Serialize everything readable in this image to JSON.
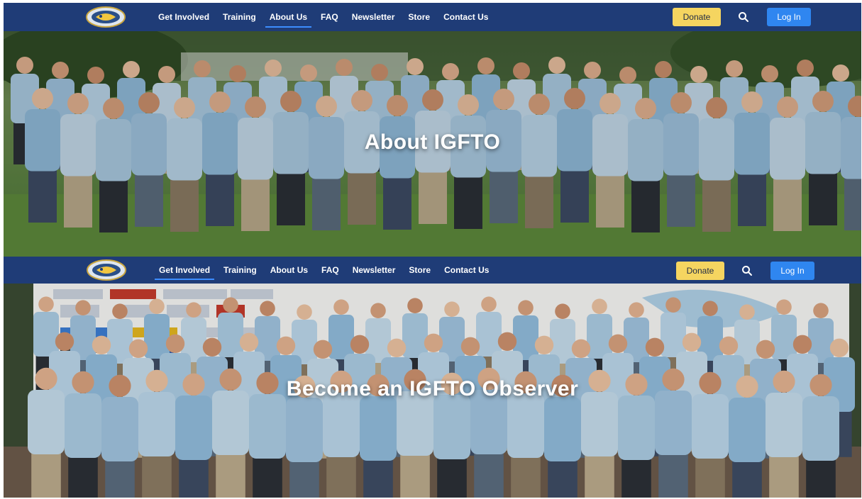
{
  "screens": [
    {
      "nav": {
        "items": [
          "Get Involved",
          "Training",
          "About Us",
          "FAQ",
          "Newsletter",
          "Store",
          "Contact Us"
        ],
        "active_index": 2,
        "donate_label": "Donate",
        "login_label": "Log In",
        "search_icon": "search-icon",
        "logo_icon": "fish-logo-icon"
      },
      "hero": {
        "title": "About IGFTO"
      }
    },
    {
      "nav": {
        "items": [
          "Get Involved",
          "Training",
          "About Us",
          "FAQ",
          "Newsletter",
          "Store",
          "Contact Us"
        ],
        "active_index": 0,
        "donate_label": "Donate",
        "login_label": "Log In",
        "search_icon": "search-icon",
        "logo_icon": "fish-logo-icon"
      },
      "hero": {
        "title": "Become an IGFTO Observer"
      }
    }
  ],
  "colors": {
    "nav_bg": "#1f3c77",
    "donate_bg": "#f5d560",
    "login_bg": "#2f86f0",
    "active_underline": "#3c8dff",
    "shirt": "#a9c9e0",
    "grass": "#5f8a3e"
  }
}
